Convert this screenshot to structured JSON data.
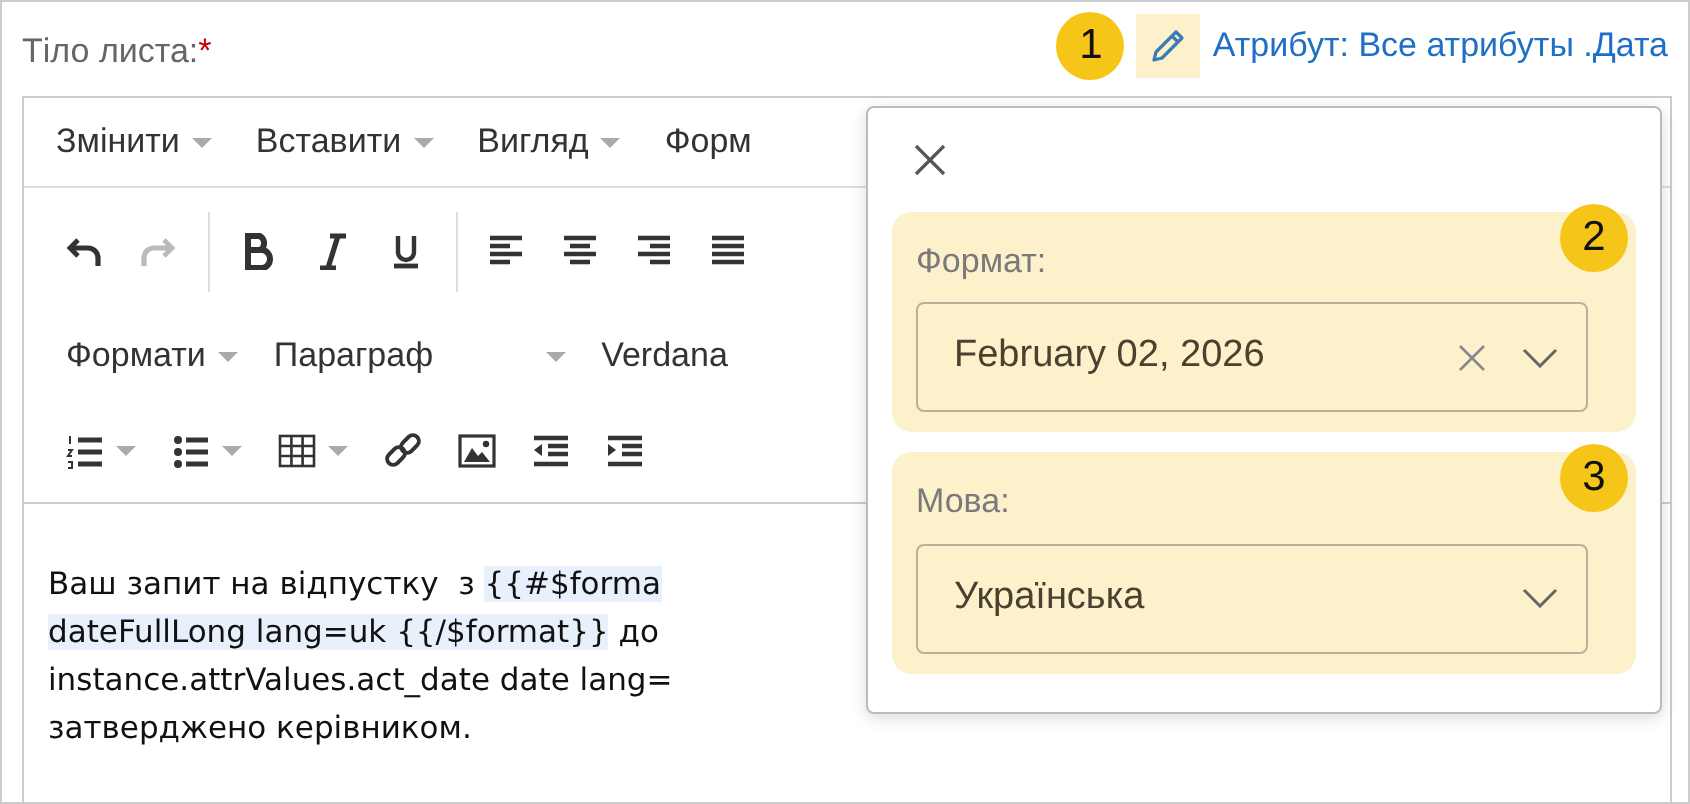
{
  "field": {
    "label": "Тіло листа:",
    "required_mark": "*"
  },
  "attribute_link": {
    "badge": "1",
    "text": "Атрибут: Все атрибуты .Дата"
  },
  "menubar": [
    {
      "label": "Змінити",
      "caret": true
    },
    {
      "label": "Вставити",
      "caret": true
    },
    {
      "label": "Вигляд",
      "caret": true
    },
    {
      "label": "Форм",
      "caret": false
    }
  ],
  "toolbar_rows": [
    [
      {
        "kind": "undo",
        "disabled": false
      },
      {
        "kind": "redo",
        "disabled": true
      },
      {
        "kind": "sep"
      },
      {
        "kind": "bold"
      },
      {
        "kind": "italic"
      },
      {
        "kind": "underline"
      },
      {
        "kind": "sep"
      },
      {
        "kind": "align-left"
      },
      {
        "kind": "align-center"
      },
      {
        "kind": "align-right"
      },
      {
        "kind": "align-justify"
      }
    ],
    [
      {
        "kind": "dropdown",
        "label": "Формати"
      },
      {
        "kind": "dropdown-wide",
        "label": "Параграф"
      },
      {
        "kind": "text",
        "label": "Verdana"
      }
    ],
    [
      {
        "kind": "ordered-list",
        "caret": true
      },
      {
        "kind": "bullet-list",
        "caret": true
      },
      {
        "kind": "table",
        "caret": true
      },
      {
        "kind": "link"
      },
      {
        "kind": "image"
      },
      {
        "kind": "outdent"
      },
      {
        "kind": "indent"
      }
    ]
  ],
  "body_lines": [
    [
      {
        "text": "Ваш запит на відпустку  з ",
        "template": false
      },
      {
        "text": "{{#$forma",
        "template": true
      }
    ],
    [
      {
        "text": "dateFullLong lang=uk {{/$format}}",
        "template": true
      },
      {
        "text": " до",
        "template": false
      }
    ],
    [
      {
        "text": "instance.attrValues.act_date date lang=",
        "template": false
      }
    ],
    [
      {
        "text": "затверджено керівником.",
        "template": false
      }
    ]
  ],
  "popup": {
    "fields": [
      {
        "badge": "2",
        "label": "Формат:",
        "value": "February 02, 2026",
        "clearable": true
      },
      {
        "badge": "3",
        "label": "Мова:",
        "value": "Українська",
        "clearable": false
      }
    ]
  }
}
